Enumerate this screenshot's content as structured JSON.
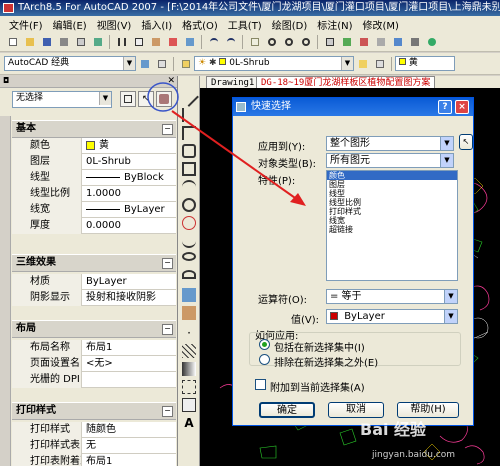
{
  "window": {
    "title": "TArch8.5 For AutoCAD 2007 - [F:\\2014年公司文件\\厦门龙湖项目\\厦门灌口项目\\厦门灌口项目\\上海鼎未别墅竣工图\\she"
  },
  "menu": [
    "文件(F)",
    "编辑(E)",
    "视图(V)",
    "插入(I)",
    "格式(O)",
    "工具(T)",
    "绘图(D)",
    "标注(N)",
    "修改(M)"
  ],
  "toolbar2": {
    "workspace": "AutoCAD 经典",
    "layer": "0L-Shrub",
    "color_label": "黄"
  },
  "tabs": {
    "drawing1": "Drawing1",
    "active": "DG-18~19厦门龙湖样板区植物配置图方案"
  },
  "panel": {
    "selection": "无选择",
    "sections": {
      "basic": "基本",
      "three_d": "三维效果",
      "layout": "布局",
      "print": "打印样式"
    },
    "basic_rows": [
      {
        "key": "颜色",
        "value": "黄",
        "swatch": "#ffff00"
      },
      {
        "key": "图层",
        "value": "0L-Shrub"
      },
      {
        "key": "线型",
        "value": "ByBlock"
      },
      {
        "key": "线型比例",
        "value": "1.0000"
      },
      {
        "key": "线宽",
        "value": "ByLayer"
      },
      {
        "key": "厚度",
        "value": "0.0000"
      }
    ],
    "three_d_rows": [
      {
        "key": "材质",
        "value": "ByLayer"
      },
      {
        "key": "阴影显示",
        "value": "投射和接收阴影"
      }
    ],
    "layout_rows": [
      {
        "key": "布局名称",
        "value": "布局1"
      },
      {
        "key": "页面设置名",
        "value": "<无>"
      },
      {
        "key": "光栅的 DPI",
        "value": ""
      }
    ],
    "print_rows": [
      {
        "key": "打印样式",
        "value": "随颜色"
      },
      {
        "key": "打印样式表",
        "value": "无"
      },
      {
        "key": "打印表附着到",
        "value": "布局1"
      }
    ]
  },
  "dialog": {
    "title": "快速选择",
    "apply_to_label": "应用到(Y):",
    "apply_to_value": "整个图形",
    "object_type_label": "对象类型(B):",
    "object_type_value": "所有图元",
    "property_label": "特性(P):",
    "properties": [
      "颜色",
      "图层",
      "线型",
      "线型比例",
      "打印样式",
      "线宽",
      "超链接"
    ],
    "operator_label": "运算符(O):",
    "operator_value": "= 等于",
    "value_label": "值(V):",
    "value_value": "ByLayer",
    "value_swatch": "#cc0000",
    "how_apply_label": "如何应用:",
    "include_label": "包括在新选择集中(I)",
    "exclude_label": "排除在新选择集之外(E)",
    "append_label": "附加到当前选择集(A)",
    "ok": "确定",
    "cancel": "取消",
    "help": "帮助(H)"
  },
  "watermark": {
    "brand": "Bai 经验",
    "url": "jingyan.baidu.com"
  },
  "colors": {
    "titlebar": "#0a246a",
    "dialog_title": "#0a5bd6",
    "arrow": "#e02020",
    "selection": "#316ac5"
  }
}
